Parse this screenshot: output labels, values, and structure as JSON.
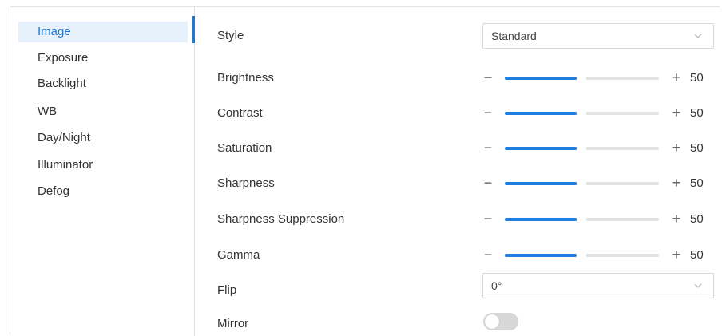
{
  "sidebar": {
    "items": [
      {
        "label": "Image",
        "active": true
      },
      {
        "label": "Exposure"
      },
      {
        "label": "Backlight"
      },
      {
        "label": "WB"
      },
      {
        "label": "Day/Night"
      },
      {
        "label": "Illuminator"
      },
      {
        "label": "Defog"
      }
    ]
  },
  "settings": {
    "style": {
      "label": "Style",
      "value": "Standard"
    },
    "sliders": [
      {
        "label": "Brightness",
        "value": "50",
        "minus": "−",
        "plus": "+",
        "fraction": 0.5
      },
      {
        "label": "Contrast",
        "value": "50",
        "minus": "−",
        "plus": "+",
        "fraction": 0.5
      },
      {
        "label": "Saturation",
        "value": "50",
        "minus": "−",
        "plus": "+",
        "fraction": 0.5
      },
      {
        "label": "Sharpness",
        "value": "50",
        "minus": "−",
        "plus": "+",
        "fraction": 0.5
      },
      {
        "label": "Sharpness Suppression",
        "value": "50",
        "minus": "−",
        "plus": "+",
        "fraction": 0.5
      },
      {
        "label": "Gamma",
        "value": "50",
        "minus": "−",
        "plus": "+",
        "fraction": 0.5
      }
    ],
    "flip": {
      "label": "Flip",
      "value": "0°"
    },
    "mirror": {
      "label": "Mirror",
      "on": false
    }
  },
  "colors": {
    "accent": "#1a78d6",
    "slider_fill": "#1f7ee0",
    "track": "#e3e3e3"
  }
}
